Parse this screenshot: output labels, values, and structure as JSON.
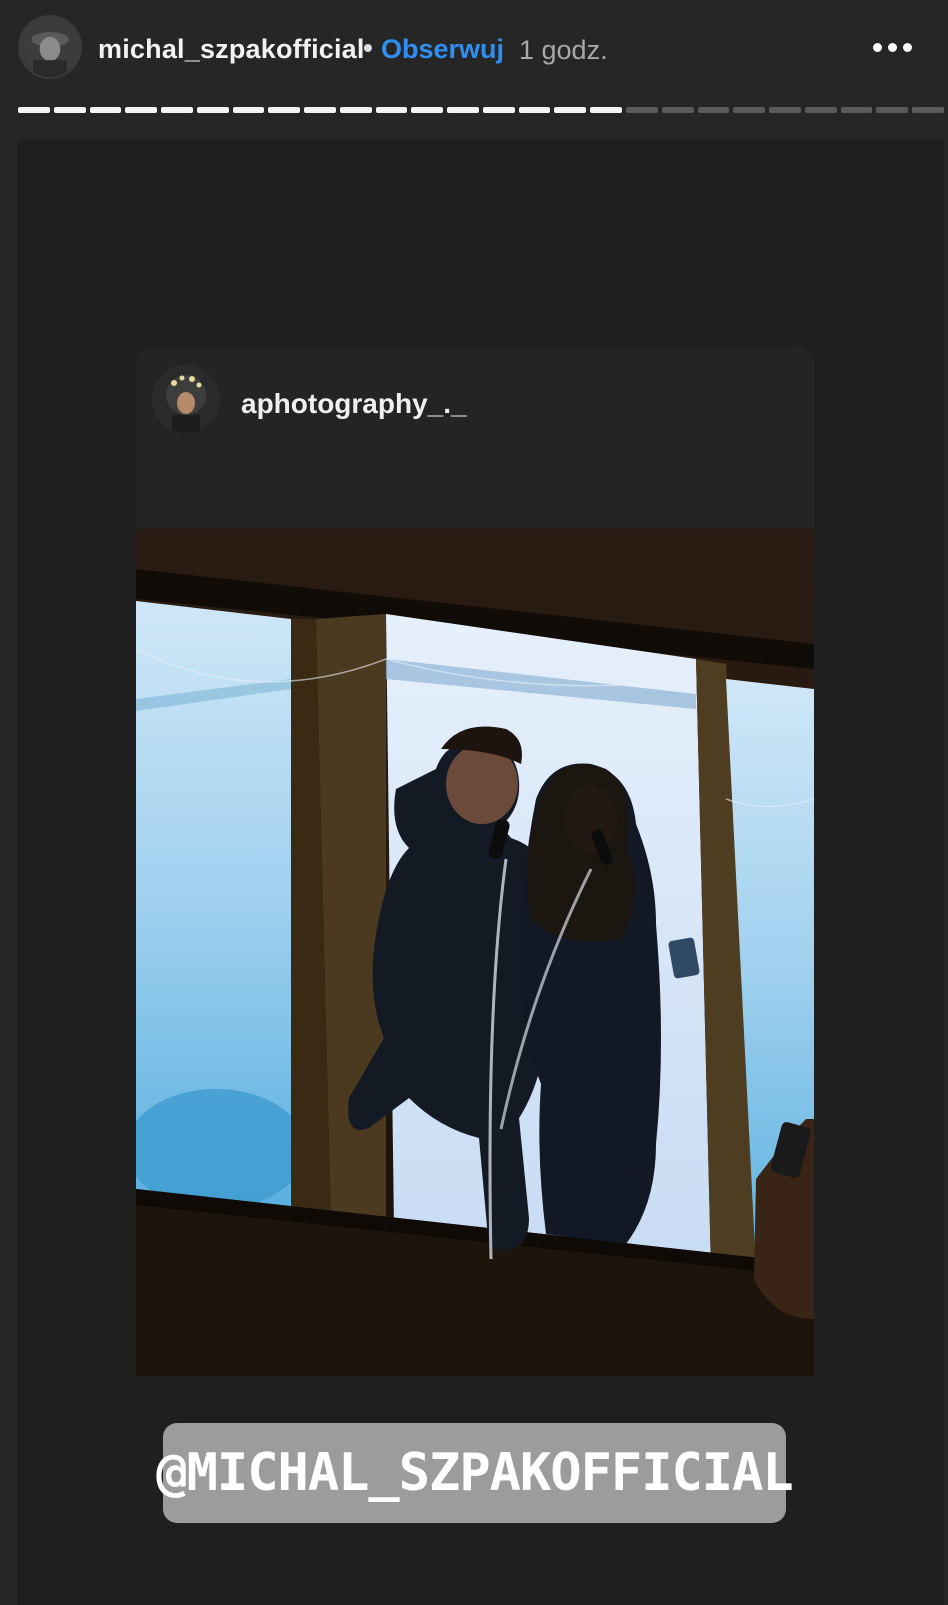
{
  "header": {
    "username": "michal_szpakofficial",
    "separator": "•",
    "follow_label": "Obserwuj",
    "time_ago": "1 godz.",
    "more_icon": "more-horizontal-icon"
  },
  "progress": {
    "segments_total": 26,
    "segments_viewed": 17
  },
  "shared_post": {
    "username": "aphotography_._",
    "photo_subject": "two singers with microphones in a window"
  },
  "mention_sticker": {
    "label": "@MICHAL_SZPAKOFFICIAL"
  },
  "colors": {
    "background": "#262626",
    "follow_blue": "#2f8ff0",
    "sticker_gray": "#9c9c9c"
  }
}
